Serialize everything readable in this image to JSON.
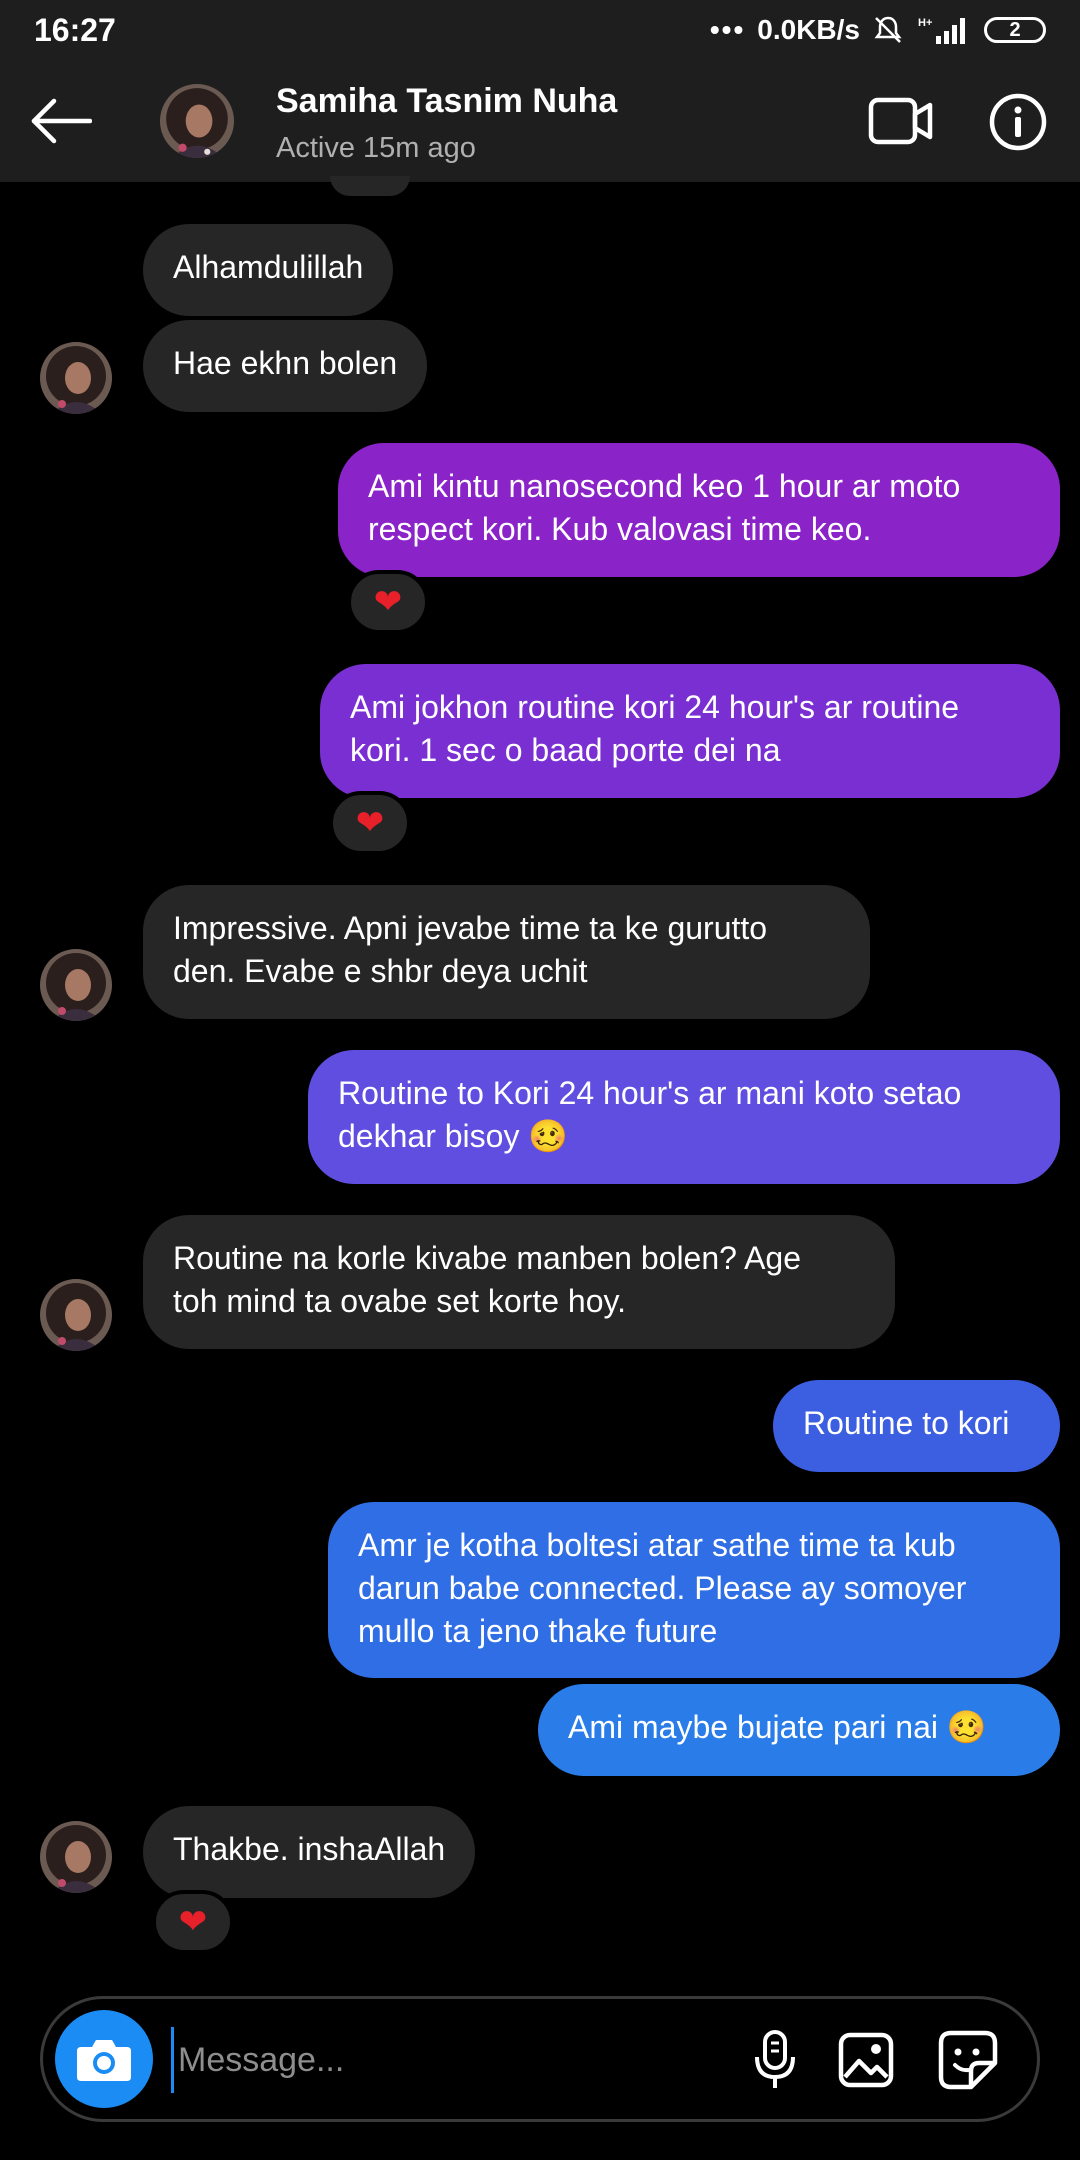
{
  "status_bar": {
    "time": "16:27",
    "network_speed": "0.0KB/s",
    "network_type": "H+",
    "battery_label": "2"
  },
  "header": {
    "contact_name": "Samiha Tasnim Nuha",
    "active_status": "Active 15m ago"
  },
  "messages": [
    {
      "id": "m1",
      "text": "Alhamdulillah",
      "sender": "contact"
    },
    {
      "id": "m2",
      "text": "Hae ekhn bolen",
      "sender": "contact"
    },
    {
      "id": "m3",
      "text": "Ami kintu nanosecond keo 1 hour ar moto\nrespect kori. Kub valovasi time keo.",
      "sender": "me",
      "reaction": "❤"
    },
    {
      "id": "m4",
      "text": "Ami jokhon routine kori 24 hour's ar routine\nkori. 1 sec o baad porte dei na",
      "sender": "me",
      "reaction": "❤"
    },
    {
      "id": "m5",
      "text": "Impressive. Apni jevabe time ta ke gurutto\nden. Evabe e shbr deya uchit",
      "sender": "contact"
    },
    {
      "id": "m6",
      "text": "Routine to Kori 24 hour's ar mani koto setao\ndekhar bisoy 🥴",
      "sender": "me"
    },
    {
      "id": "m7",
      "text": "Routine na korle kivabe manben bolen? Age\ntoh mind ta ovabe set korte hoy.",
      "sender": "contact"
    },
    {
      "id": "m8",
      "text": "Routine to kori",
      "sender": "me"
    },
    {
      "id": "m9",
      "text": "Amr je kotha boltesi atar sathe time ta kub\ndarun babe connected. Please ay somoyer\nmullo ta jeno thake future",
      "sender": "me"
    },
    {
      "id": "m10",
      "text": "Ami maybe bujate pari nai 🥴",
      "sender": "me"
    },
    {
      "id": "m11",
      "text": "Thakbe. inshaAllah",
      "sender": "contact",
      "reaction": "❤"
    }
  ],
  "composer": {
    "placeholder": "Message..."
  },
  "colors": {
    "incoming_bubble": "#262626",
    "outgoing_purple": "#8a23c8",
    "outgoing_blue": "#2a78e6",
    "camera_button": "#1a8cf4",
    "reaction_heart": "#e8202a"
  },
  "icons": {
    "back": "back-arrow-icon",
    "video": "video-call-icon",
    "info": "info-icon",
    "camera": "camera-icon",
    "mic": "microphone-icon",
    "gallery": "gallery-icon",
    "sticker": "sticker-icon"
  }
}
